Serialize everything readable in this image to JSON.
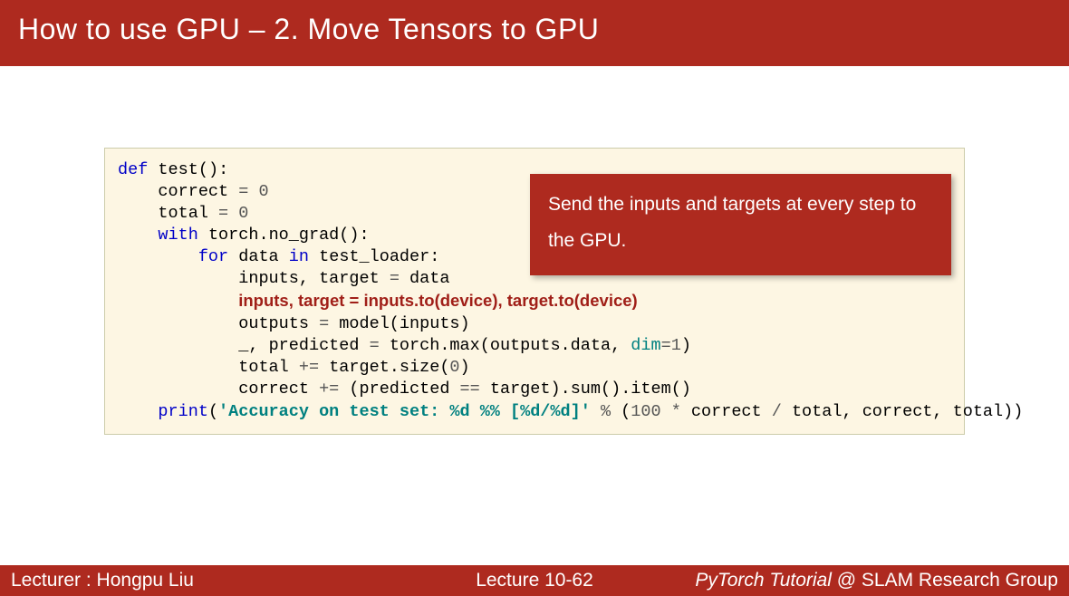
{
  "header": {
    "title": "How to use GPU – 2. Move Tensors to GPU"
  },
  "callout": {
    "text": "Send the inputs and targets at every step to the GPU."
  },
  "code": {
    "def": "def",
    "test_name": "test",
    "correct": "correct",
    "total": "total",
    "with": "with",
    "torch_nograd": "torch.no_grad",
    "for": "for",
    "data": "data",
    "in": "in",
    "test_loader": "test_loader",
    "inputs": "inputs",
    "target": "target",
    "highlight_line": "inputs, target = inputs.to(device), target.to(device)",
    "outputs": "outputs",
    "model": "model",
    "predicted": "predicted",
    "torch_max": "torch.max",
    "outputs_data": "outputs.data",
    "dim": "dim",
    "dim_val": "1",
    "size": "target.size",
    "zero": "0",
    "sum_item": ").sum().item()",
    "print": "print",
    "str_literal": "'Accuracy on test set: %d %% [%d/%d]'",
    "percent": "%",
    "hundred": "100",
    "star": "*",
    "correct2": "correct",
    "slash": "/",
    "total2": "total",
    "eq": "=",
    "pluseq": "+=",
    "eqeq": "==",
    "comma": ",",
    "lparen": "(",
    "rparen": ")",
    "colon": ":",
    "underscore": "_"
  },
  "footer": {
    "lecturer": "Lecturer : Hongpu Liu",
    "lecture": "Lecture 10-62",
    "series": "PyTorch Tutorial",
    "group": " @ SLAM Research Group"
  }
}
